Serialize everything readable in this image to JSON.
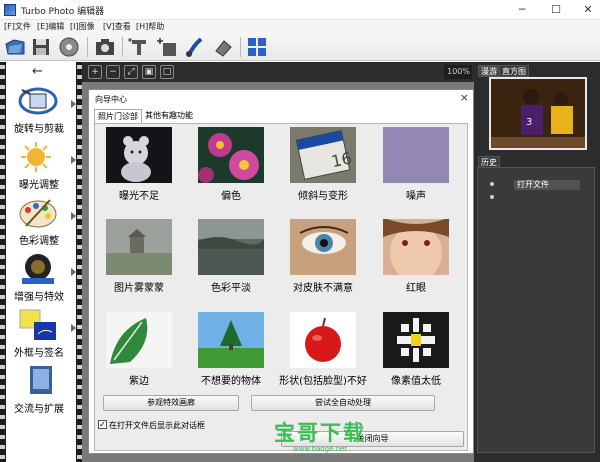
{
  "window": {
    "title": "Turbo Photo 编辑器",
    "controls": [
      "─",
      "☐",
      "✕"
    ]
  },
  "menu": [
    "[F]文件",
    "[E]编辑",
    "[I]图像",
    "[V]查看",
    "[H]帮助"
  ],
  "left_nav": {
    "items": [
      {
        "label": "旋转与剪裁",
        "icon": "rotate-crop-icon"
      },
      {
        "label": "曝光调整",
        "icon": "exposure-icon"
      },
      {
        "label": "色彩调整",
        "icon": "palette-icon"
      },
      {
        "label": "增强与特效",
        "icon": "enhance-icon"
      },
      {
        "label": "外框与签名",
        "icon": "frame-icon"
      },
      {
        "label": "交流与扩展",
        "icon": "share-icon"
      }
    ],
    "back_arrow": "←"
  },
  "view_toolbar": {
    "zoom": "100%"
  },
  "dialog": {
    "title": "向导中心",
    "close": "×",
    "tabs": [
      "照片门诊部",
      "其他有趣功能"
    ],
    "active_tab": 0,
    "items": [
      {
        "label": "曝光不足",
        "icon": "teddy-bear-photo"
      },
      {
        "label": "偏色",
        "icon": "flowers-photo"
      },
      {
        "label": "倾斜与变形",
        "icon": "memory-card-photo"
      },
      {
        "label": "噪声",
        "icon": "noise-photo"
      },
      {
        "label": "图片雾蒙蒙",
        "icon": "foggy-landscape-photo"
      },
      {
        "label": "色彩平淡",
        "icon": "dull-lake-photo"
      },
      {
        "label": "对皮肤不满意",
        "icon": "eye-closeup-photo"
      },
      {
        "label": "红眼",
        "icon": "face-photo"
      },
      {
        "label": "紫边",
        "icon": "leaf-photo"
      },
      {
        "label": "不想要的物体",
        "icon": "tree-field-photo"
      },
      {
        "label": "形状(包括脸型)不好",
        "icon": "apple-photo"
      },
      {
        "label": "像素值太低",
        "icon": "pixel-flower-photo"
      }
    ],
    "buttons": {
      "effects_gallery": "参观特效画廊",
      "auto_process": "尝试全自动处理",
      "close_wizard": "关闭向导"
    },
    "startup_checkbox": {
      "label": "在打开文件后显示此对话框",
      "checked": true
    }
  },
  "right_panel": {
    "tabs": [
      "漫游",
      "直方图"
    ],
    "history_title": "历史",
    "history_items": [
      "打开文件"
    ]
  },
  "watermark": {
    "text": "宝哥下载",
    "url": "www.baoge.net"
  }
}
